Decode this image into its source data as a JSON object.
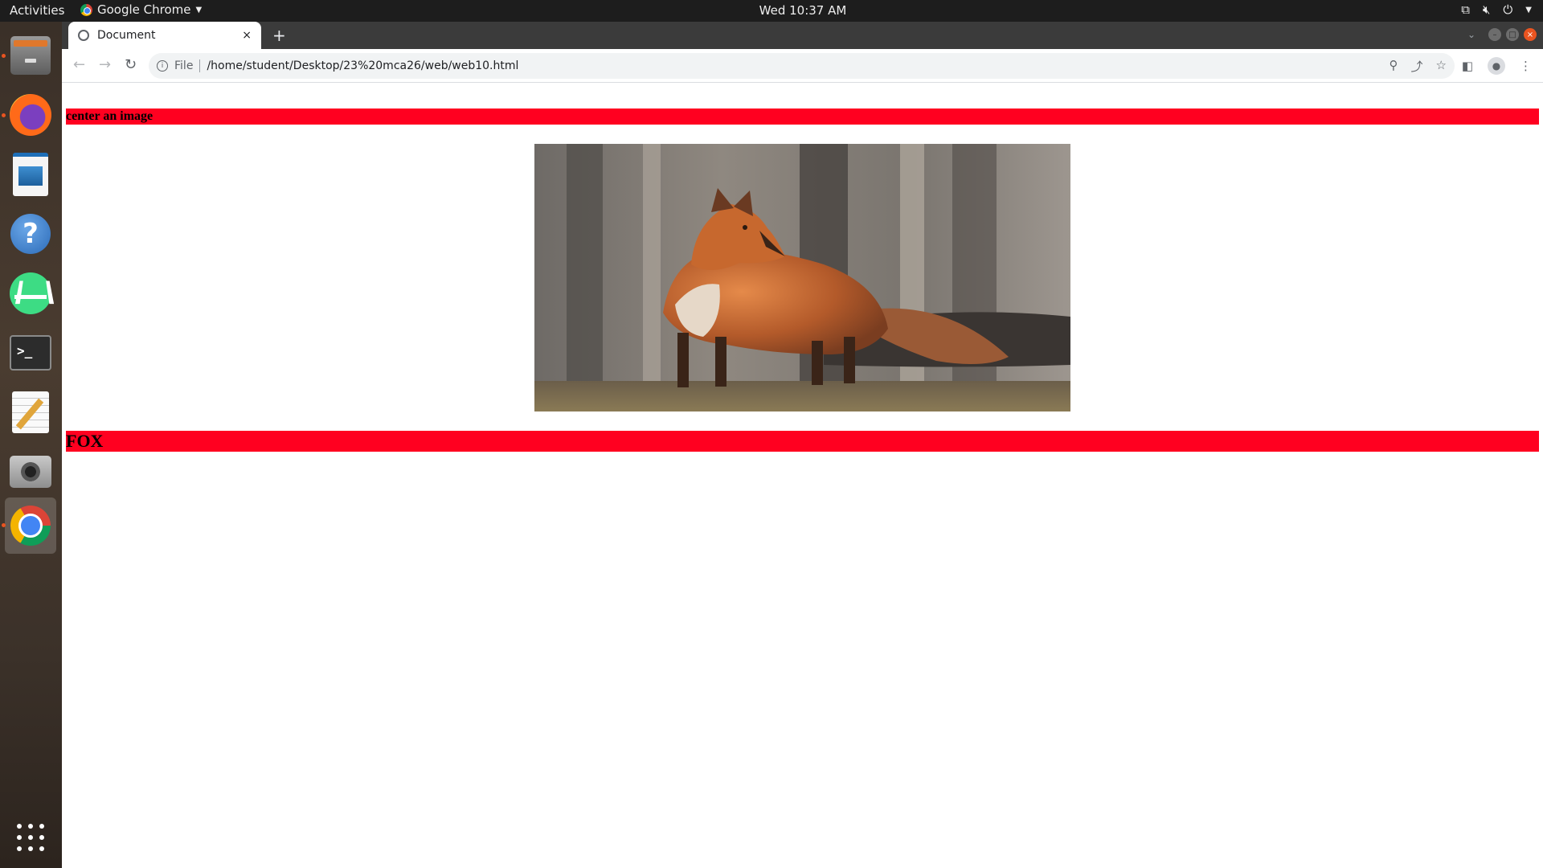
{
  "topbar": {
    "activities": "Activities",
    "app_name": "Google Chrome",
    "clock": "Wed 10:37 AM",
    "tray_icons": [
      "network-icon",
      "volume-muted-icon",
      "power-icon",
      "caret-down-icon"
    ]
  },
  "dock": {
    "items": [
      {
        "name": "files",
        "icon": "files-icon",
        "running": true
      },
      {
        "name": "firefox",
        "icon": "firefox-icon",
        "running": true
      },
      {
        "name": "libreoffice-writer",
        "icon": "writer-icon",
        "running": false
      },
      {
        "name": "help",
        "icon": "help-icon",
        "running": false
      },
      {
        "name": "android-studio",
        "icon": "android-studio-icon",
        "running": false
      },
      {
        "name": "terminal",
        "icon": "terminal-icon",
        "running": false
      },
      {
        "name": "text-editor",
        "icon": "text-editor-icon",
        "running": false
      },
      {
        "name": "camera",
        "icon": "camera-icon",
        "running": false
      },
      {
        "name": "chrome",
        "icon": "chrome-icon",
        "running": true,
        "active": true
      }
    ],
    "help_glyph": "?",
    "terminal_glyph": ">_",
    "apps_grid_icon": "app-grid-icon"
  },
  "browser": {
    "tab_title": "Document",
    "tab_close": "×",
    "new_tab": "+",
    "scheme_label": "File",
    "url": "/home/student/Desktop/23%20mca26/web/web10.html"
  },
  "page": {
    "heading_top": "center an image",
    "image_subject": "fox",
    "heading_bottom": "FOX",
    "heading_color": "#ff0020"
  },
  "colors": {
    "topbar": "#1d1d1d",
    "tabstrip": "#3b3b3b",
    "ubuntu_orange": "#e95420"
  }
}
